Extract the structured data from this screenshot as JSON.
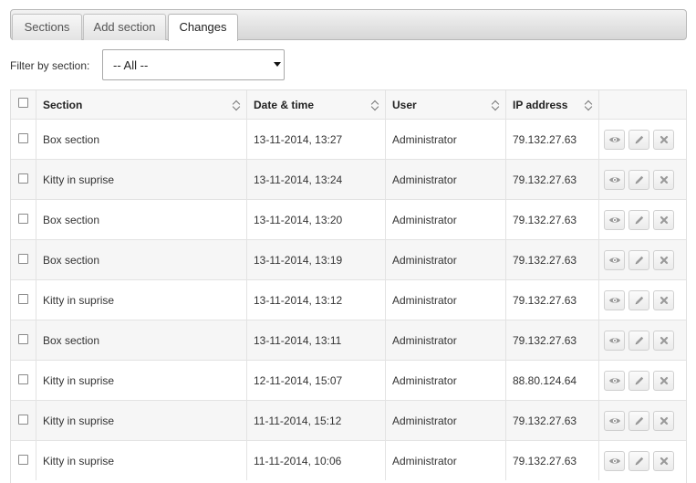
{
  "tabs": [
    {
      "label": "Sections",
      "active": false
    },
    {
      "label": "Add section",
      "active": false
    },
    {
      "label": "Changes",
      "active": true
    }
  ],
  "filter": {
    "label": "Filter by section:",
    "selected": "-- All --"
  },
  "table": {
    "columns": [
      "Section",
      "Date & time",
      "User",
      "IP address"
    ],
    "rows": [
      {
        "section": "Box section",
        "datetime": "13-11-2014, 13:27",
        "user": "Administrator",
        "ip": "79.132.27.63"
      },
      {
        "section": "Kitty in suprise",
        "datetime": "13-11-2014, 13:24",
        "user": "Administrator",
        "ip": "79.132.27.63"
      },
      {
        "section": "Box section",
        "datetime": "13-11-2014, 13:20",
        "user": "Administrator",
        "ip": "79.132.27.63"
      },
      {
        "section": "Box section",
        "datetime": "13-11-2014, 13:19",
        "user": "Administrator",
        "ip": "79.132.27.63"
      },
      {
        "section": "Kitty in suprise",
        "datetime": "13-11-2014, 13:12",
        "user": "Administrator",
        "ip": "79.132.27.63"
      },
      {
        "section": "Box section",
        "datetime": "13-11-2014, 13:11",
        "user": "Administrator",
        "ip": "79.132.27.63"
      },
      {
        "section": "Kitty in suprise",
        "datetime": "12-11-2014, 15:07",
        "user": "Administrator",
        "ip": "88.80.124.64"
      },
      {
        "section": "Kitty in suprise",
        "datetime": "11-11-2014, 15:12",
        "user": "Administrator",
        "ip": "79.132.27.63"
      },
      {
        "section": "Kitty in suprise",
        "datetime": "11-11-2014, 10:06",
        "user": "Administrator",
        "ip": "79.132.27.63"
      }
    ],
    "row_actions": [
      "view-icon",
      "edit-icon",
      "delete-icon"
    ]
  },
  "colors": {
    "icon": "#9a9a9a",
    "row_alt": "#f6f6f6",
    "border": "#e3e3e3"
  }
}
